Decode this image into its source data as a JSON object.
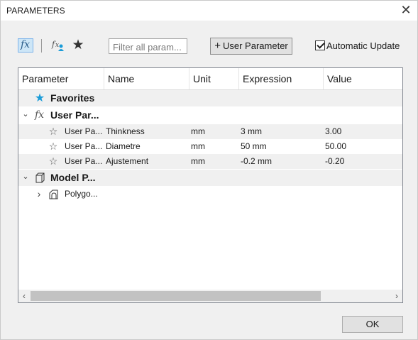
{
  "window": {
    "title": "PARAMETERS",
    "close_glyph": "✕"
  },
  "toolbar": {
    "fx_icon_glyph": "fx",
    "fx_user_icon": "fx-user-icon",
    "favorites_icon_glyph": "★",
    "filter_placeholder": "Filter all param...",
    "user_parameter_label": "User Parameter",
    "plus_glyph": "+",
    "auto_update_label": "Automatic Update",
    "auto_update_checked": true
  },
  "table": {
    "columns": [
      "Parameter",
      "Name",
      "Unit",
      "Expression",
      "Value"
    ],
    "groups": {
      "favorites": {
        "label": "Favorites",
        "icon_glyph": "★",
        "icon_color": "#1b9cd8"
      },
      "user": {
        "label": "User Par...",
        "icon_glyph": "fx",
        "expander": "⌄"
      },
      "model": {
        "label": "Model P...",
        "expander": "⌄"
      }
    },
    "user_rows": [
      {
        "parameter": "User Pa...",
        "name": "Thinkness",
        "unit": "mm",
        "expression": "3 mm",
        "value": "3.00"
      },
      {
        "parameter": "User Pa...",
        "name": "Diametre",
        "unit": "mm",
        "expression": "50 mm",
        "value": "50.00"
      },
      {
        "parameter": "User Pa...",
        "name": "Ajustement",
        "unit": "mm",
        "expression": "-0.2 mm",
        "value": "-0.20"
      }
    ],
    "model_children": [
      {
        "label": "Polygo...",
        "expander": "›"
      }
    ],
    "scroll_left": "‹",
    "scroll_right": "›"
  },
  "footer": {
    "ok_label": "OK"
  }
}
